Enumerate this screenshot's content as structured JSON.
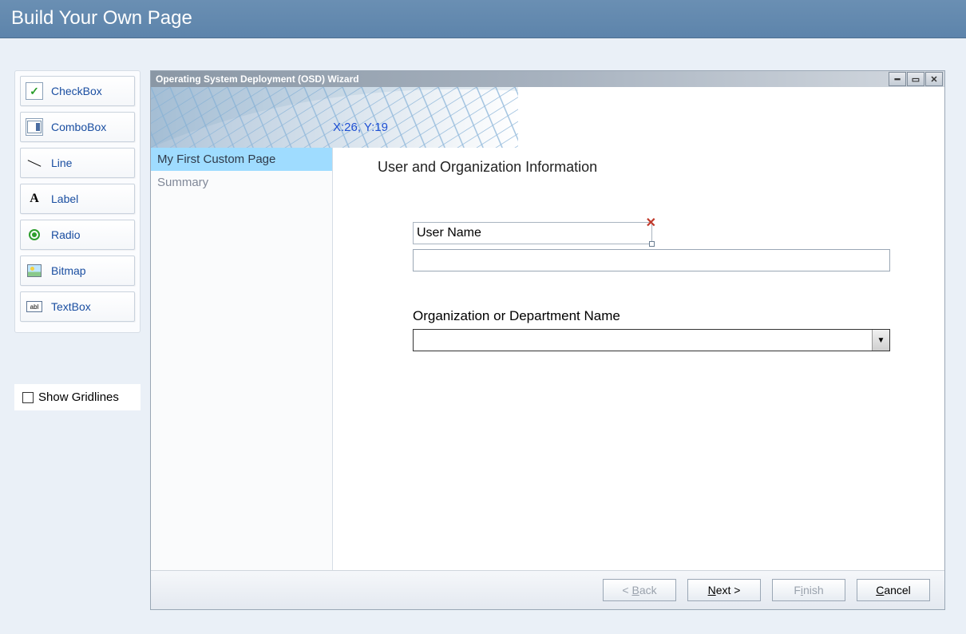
{
  "header": {
    "title": "Build Your Own Page"
  },
  "toolbox": {
    "items": [
      {
        "label": "CheckBox"
      },
      {
        "label": "ComboBox"
      },
      {
        "label": "Line"
      },
      {
        "label": "Label"
      },
      {
        "label": "Radio"
      },
      {
        "label": "Bitmap"
      },
      {
        "label": "TextBox"
      }
    ]
  },
  "show_gridlines_label": "Show Gridlines",
  "wizard": {
    "title": "Operating System Deployment (OSD) Wizard",
    "coords": "X:26, Y:19",
    "steps": [
      {
        "label": "My First Custom Page",
        "active": true
      },
      {
        "label": "Summary",
        "active": false
      }
    ],
    "page_title": "User and Organization Information",
    "user_name_label": "User Name",
    "user_name_value": "",
    "org_label": "Organization or Department Name",
    "org_value": "",
    "footer": {
      "back": "< Back",
      "next": "Next >",
      "finish": "Finish",
      "cancel": "Cancel"
    }
  }
}
